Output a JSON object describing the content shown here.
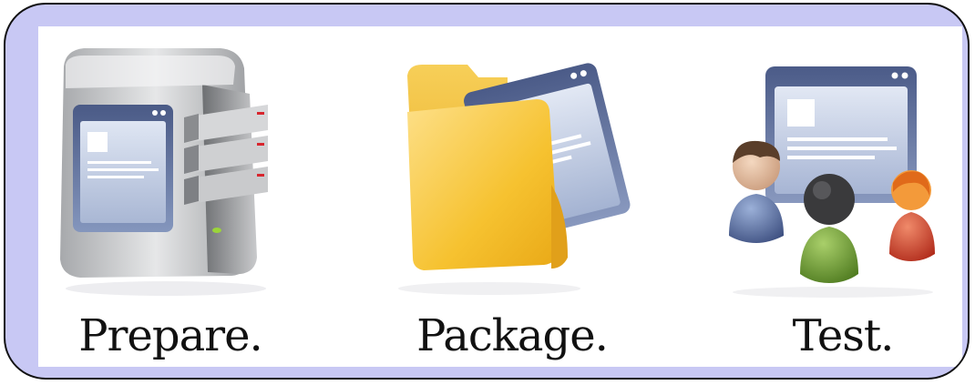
{
  "steps": [
    {
      "label": "Prepare.",
      "icon": "server-icon"
    },
    {
      "label": "Package.",
      "icon": "folder-icon"
    },
    {
      "label": "Test.",
      "icon": "users-icon"
    }
  ],
  "colors": {
    "frame_fill": "#c8c8f4",
    "frame_border": "#111111",
    "panel": "#ffffff",
    "folder": "#f6c230",
    "window": "#5e6f99"
  }
}
